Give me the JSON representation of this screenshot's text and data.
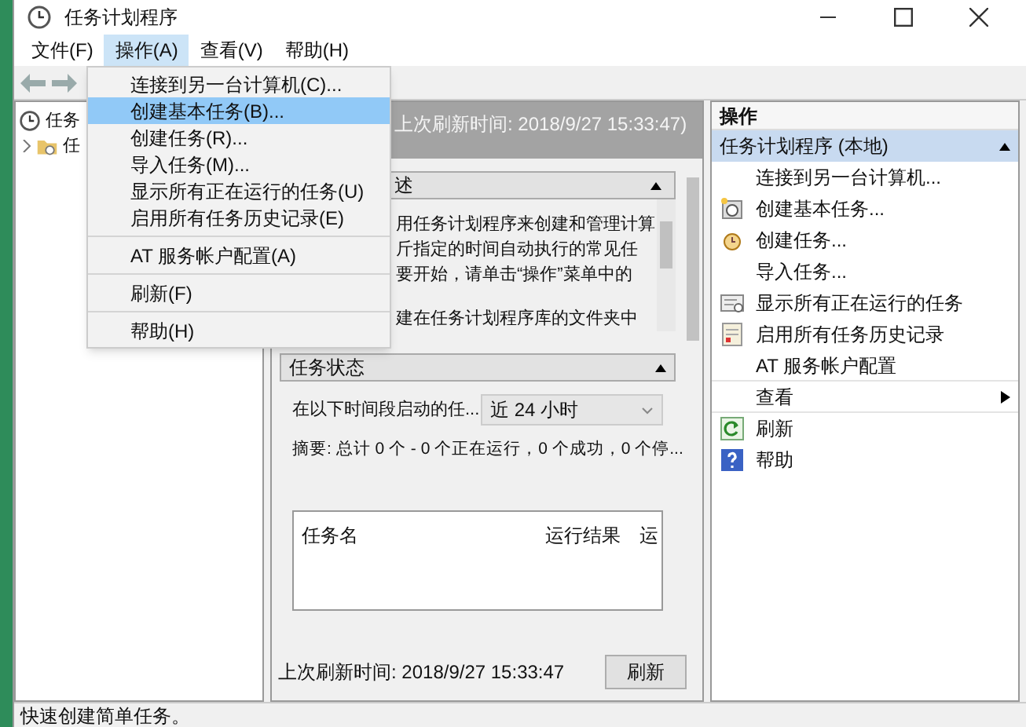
{
  "window": {
    "title": "任务计划程序"
  },
  "menu_bar": [
    {
      "label": "文件(F)",
      "selected": false
    },
    {
      "label": "操作(A)",
      "selected": true
    },
    {
      "label": "查看(V)",
      "selected": false
    },
    {
      "label": "帮助(H)",
      "selected": false
    }
  ],
  "dropdown": [
    {
      "label": "连接到另一台计算机(C)...",
      "selected": false,
      "separator_after": false
    },
    {
      "label": "创建基本任务(B)...",
      "selected": true,
      "separator_after": false
    },
    {
      "label": "创建任务(R)...",
      "selected": false,
      "separator_after": false
    },
    {
      "label": "导入任务(M)...",
      "selected": false,
      "separator_after": false
    },
    {
      "label": "显示所有正在运行的任务(U)",
      "selected": false,
      "separator_after": false
    },
    {
      "label": "启用所有任务历史记录(E)",
      "selected": false,
      "separator_after": true
    },
    {
      "label": "AT 服务帐户配置(A)",
      "selected": false,
      "separator_after": true
    },
    {
      "label": "刷新(F)",
      "selected": false,
      "separator_after": true
    },
    {
      "label": "帮助(H)",
      "selected": false,
      "separator_after": false
    }
  ],
  "tree": [
    {
      "label": "任务",
      "children": [
        {
          "label": "任",
          "expanded": false
        }
      ]
    }
  ],
  "center": {
    "header": "上次刷新时间: 2018/9/27 15:33:47)",
    "overview": {
      "title": "述",
      "expanded": true,
      "lines": [
        "用任务计划程序来创建和管理计算",
        "斤指定的时间自动执行的常见任",
        "要开始，请单击“操作”菜单中的",
        "建在任务计划程序库的文件夹中"
      ]
    },
    "status": {
      "title": "任务状态",
      "expanded": true,
      "period_label": "在以下时间段启动的任...",
      "period_value": "近 24 小时",
      "summary": "摘要: 总计 0 个 - 0 个正在运行，0 个成功，0 个停...",
      "columns": [
        "任务名",
        "运行结果",
        "运"
      ]
    },
    "footer": {
      "refresh_time": "上次刷新时间: 2018/9/27 15:33:47",
      "refresh_button": "刷新"
    }
  },
  "actions": {
    "title": "操作",
    "group": "任务计划程序 (本地)",
    "group_expanded": true,
    "items": [
      {
        "label": "连接到另一台计算机...",
        "separator_after": false,
        "submenu": false
      },
      {
        "label": "创建基本任务...",
        "separator_after": false,
        "submenu": false
      },
      {
        "label": "创建任务...",
        "separator_after": false,
        "submenu": false
      },
      {
        "label": "导入任务...",
        "separator_after": false,
        "submenu": false
      },
      {
        "label": "显示所有正在运行的任务",
        "separator_after": false,
        "submenu": false
      },
      {
        "label": "启用所有任务历史记录",
        "separator_after": false,
        "submenu": false
      },
      {
        "label": "AT 服务帐户配置",
        "separator_after": true,
        "submenu": false
      },
      {
        "label": "查看",
        "separator_after": true,
        "submenu": true
      },
      {
        "label": "刷新",
        "separator_after": false,
        "submenu": false
      },
      {
        "label": "帮助",
        "separator_after": false,
        "submenu": false
      }
    ]
  },
  "status_bar": "快速创建简单任务。"
}
